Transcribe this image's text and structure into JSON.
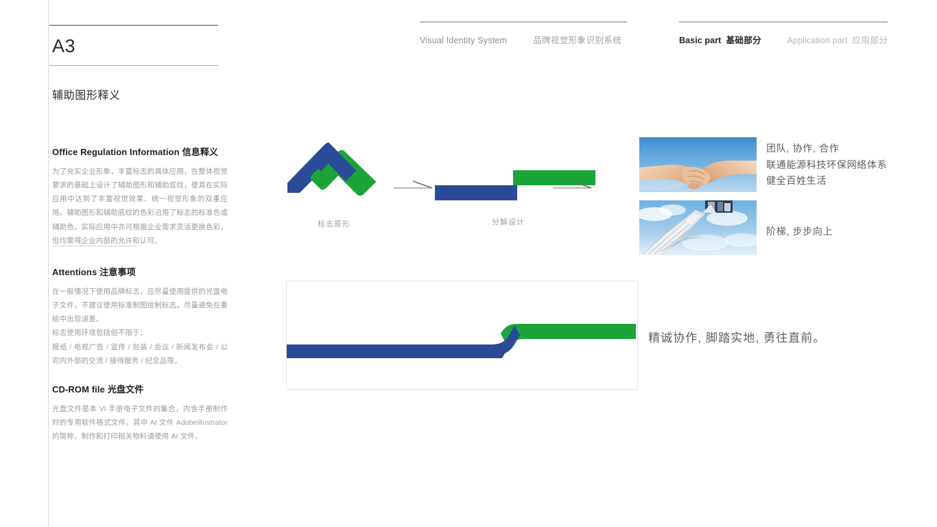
{
  "page": {
    "id": "A3",
    "section_title": "辅助图形释义"
  },
  "header": {
    "visual_identity": {
      "en": "Visual Identity System",
      "cn": "品牌视觉形象识别系统"
    },
    "parts": [
      {
        "en": "Basic part",
        "cn": "基础部分",
        "active": true
      },
      {
        "en": "Application part",
        "cn": "应用部分",
        "active": false
      }
    ]
  },
  "columns": [
    {
      "heading_en": "Office Regulation Information",
      "heading_cn": "信息释义",
      "body": "为了充实企业形象，丰富标志的具体应用，在整体视觉要求的基础上设计了辅助图形和辅助底纹，使其在实际应用中达到了丰富视觉效果、统一视觉形象的双重应用。辅助图形和辅助底纹的色彩沿用了标志的标准色或辅助色，实际应用中亦可根据企业需求灵活更换色彩，但均需得企业内部的允许和认可。"
    },
    {
      "heading_en": "Attentions",
      "heading_cn": "注意事项",
      "body": "在一般情况下使用品牌标志，应尽量使用提供的光盘电子文件，不建议使用标准制图绘制标志。尽量避免在重绘中出现误差。\n标志使用环境包括但不限于：\n报纸 / 电视广告 / 宣传 / 包装 / 会议 / 新闻发布会 / 公司内外部的交流 / 接待服务 / 纪念品等。"
    },
    {
      "heading_en": "CD-ROM file",
      "heading_cn": "光盘文件",
      "body": "光盘文件是本 VI 手册电子文件的集合，内含手册制作时的专用软件格式文件。其中 AI 文件 Adobeillustrator 的简称，制作和打印相关物料请使用 AI 文件。"
    }
  ],
  "diagram": {
    "logo_caption": "标志原形",
    "decomposition_caption": "分解设计",
    "colors": {
      "blue": "#2b4b96",
      "green": "#1ba539"
    }
  },
  "photos": [
    {
      "name": "handshake-photo",
      "caption": "团队, 协作, 合作\n联通能源科技环保网络体系\n健全百姓生活"
    },
    {
      "name": "stairway-photo",
      "caption": "阶梯, 步步向上"
    }
  ],
  "slogan": "精诚协作, 脚踏实地, 勇往直前。"
}
